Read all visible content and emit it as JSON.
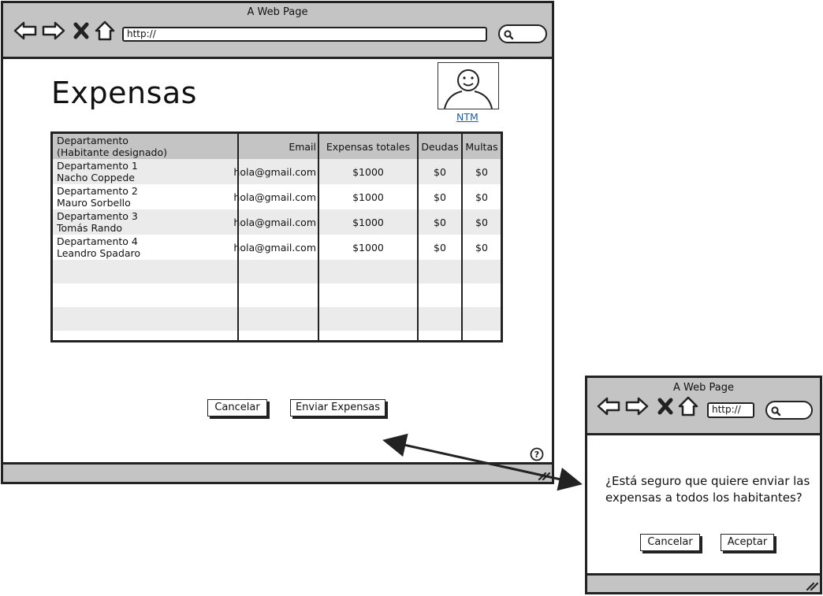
{
  "main_window": {
    "title": "A Web Page",
    "url": "http://",
    "heading": "Expensas",
    "user_link": "NTM",
    "table": {
      "headers": [
        "Departamento\n(Habitante designado)",
        "Email",
        "Expensas totales",
        "Deudas",
        "Multas"
      ],
      "rows": [
        [
          "Departamento 1\nNacho Coppede",
          "hola@gmail.com",
          "$1000",
          "$0",
          "$0"
        ],
        [
          "Departamento 2\nMauro Sorbello",
          "hola@gmail.com",
          "$1000",
          "$0",
          "$0"
        ],
        [
          "Departamento 3\nTomás Rando",
          "hola@gmail.com",
          "$1000",
          "$0",
          "$0"
        ],
        [
          "Departamento 4\nLeandro Spadaro",
          "hola@gmail.com",
          "$1000",
          "$0",
          "$0"
        ]
      ]
    },
    "buttons": {
      "cancel": "Cancelar",
      "send": "Enviar Expensas"
    },
    "help_icon": "help-icon"
  },
  "dialog_window": {
    "title": "A Web Page",
    "url": "http://",
    "message": "¿Está seguro que quiere enviar las expensas a todos los habitantes?",
    "buttons": {
      "cancel": "Cancelar",
      "accept": "Aceptar"
    }
  },
  "colors": {
    "chrome": "#c4c4c4",
    "stripe": "#ebebeb",
    "link": "#1f5fa8"
  }
}
